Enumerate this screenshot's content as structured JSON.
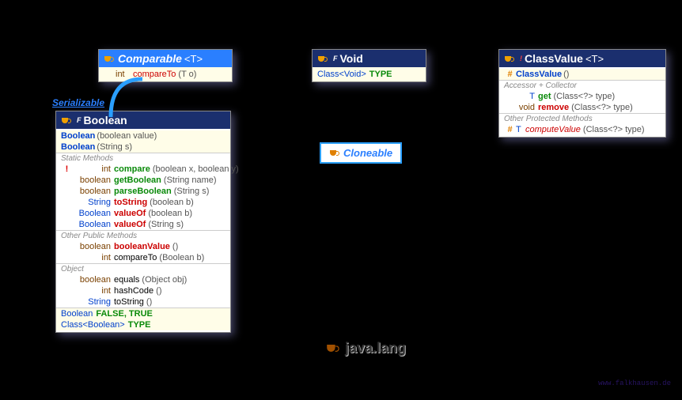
{
  "comparable": {
    "name": "Comparable",
    "typeparam": "<T>",
    "method": {
      "ret": "int",
      "name": "compareTo",
      "params": "(T o)"
    }
  },
  "serializable": "Serializable",
  "boolean": {
    "name": "Boolean",
    "modifier": "F",
    "constructors": [
      {
        "name": "Boolean",
        "params": "(boolean value)"
      },
      {
        "name": "Boolean",
        "params": "(String s)"
      }
    ],
    "section_static": "Static Methods",
    "static_methods": [
      {
        "pre": "!",
        "ret": "int",
        "name": "compare",
        "params": "(boolean x, boolean y)"
      },
      {
        "pre": "",
        "ret": "boolean",
        "name": "getBoolean",
        "params": "(String name)"
      },
      {
        "pre": "",
        "ret": "boolean",
        "name": "parseBoolean",
        "params": "(String s)"
      },
      {
        "pre": "",
        "ret": "String",
        "name": "toString",
        "params": "(boolean b)"
      },
      {
        "pre": "",
        "ret": "Boolean",
        "name": "valueOf",
        "params": "(boolean b)"
      },
      {
        "pre": "",
        "ret": "Boolean",
        "name": "valueOf",
        "params": "(String s)"
      }
    ],
    "section_public": "Other Public Methods",
    "public_methods": [
      {
        "ret": "boolean",
        "name": "booleanValue",
        "params": "()"
      },
      {
        "ret": "int",
        "name": "compareTo",
        "params": "(Boolean b)"
      }
    ],
    "section_object": "Object",
    "object_methods": [
      {
        "ret": "boolean",
        "name": "equals",
        "params": "(Object obj)"
      },
      {
        "ret": "int",
        "name": "hashCode",
        "params": "()"
      },
      {
        "ret": "String",
        "name": "toString",
        "params": "()"
      }
    ],
    "fields": [
      {
        "type": "Boolean",
        "value": "FALSE, TRUE"
      },
      {
        "type": "Class<Boolean>",
        "value": "TYPE"
      }
    ]
  },
  "void": {
    "name": "Void",
    "modifier": "F",
    "field": {
      "type": "Class<Void>",
      "value": "TYPE"
    }
  },
  "cloneable": "Cloneable",
  "classvalue": {
    "name": "ClassValue",
    "modifier": "!",
    "typeparam": "<T>",
    "constructor": {
      "pre": "#",
      "name": "ClassValue",
      "params": "()"
    },
    "section_accessor": "Accessor + Collector",
    "methods": [
      {
        "pre": "",
        "ret": "T",
        "name": "get",
        "params": "(Class<?> type)"
      },
      {
        "pre": "",
        "ret": "void",
        "name": "remove",
        "params": "(Class<?> type)"
      }
    ],
    "section_protected": "Other Protected Methods",
    "protected_methods": [
      {
        "pre": "#",
        "ret": "T",
        "name": "computeValue",
        "params": "(Class<?> type)"
      }
    ]
  },
  "package": "java.lang",
  "attribution": "www.falkhausen.de"
}
